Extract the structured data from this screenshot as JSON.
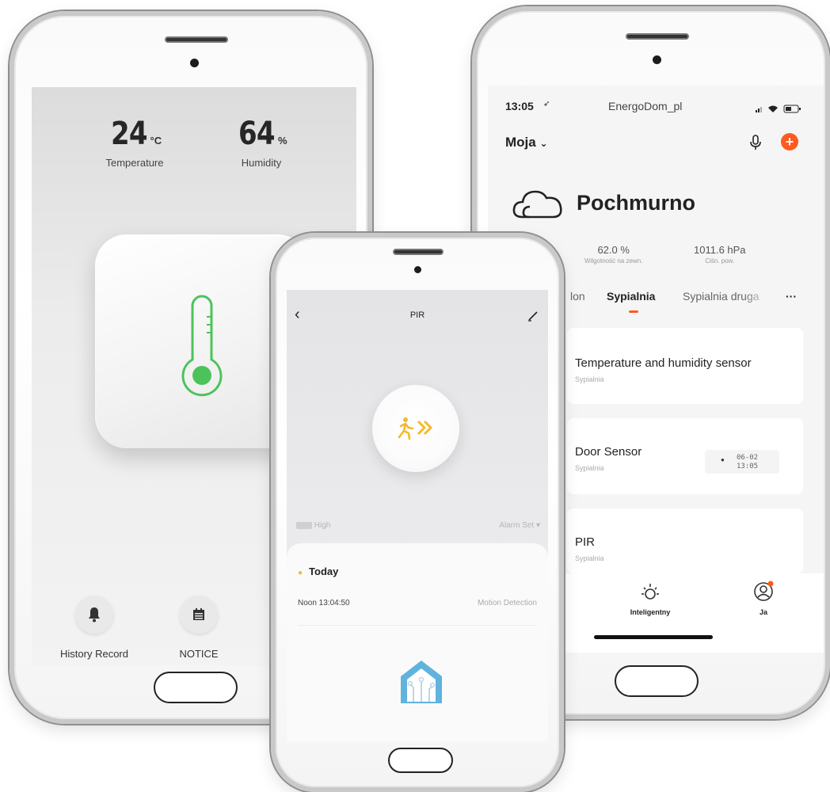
{
  "left_app": {
    "temperature_value": "24",
    "temperature_unit": "°C",
    "temperature_label": "Temperature",
    "humidity_value": "64",
    "humidity_unit": "%",
    "humidity_label": "Humidity",
    "history_label": "History Record",
    "notice_label": "NOTICE"
  },
  "right_app": {
    "status_time": "13:05",
    "carrier": "EnergoDom_pl",
    "home_name": "Moja",
    "weather": "Pochmurno",
    "stats": [
      {
        "value": "62.0 %",
        "label": "Wilgotność na zewn."
      },
      {
        "value": "1011.6 hPa",
        "label": "Ciśn. pow."
      }
    ],
    "rooms": [
      "lon",
      "Sypialnia",
      "Sypialnia druga"
    ],
    "more": "···",
    "devices": [
      {
        "name": "Temperature and humidity sensor",
        "room": "Sypialnia"
      },
      {
        "name": "Door Sensor",
        "room": "Sypialnia",
        "badge_date": "06-02",
        "badge_time": "13:05"
      },
      {
        "name": "PIR",
        "room": "Sypialnia"
      }
    ],
    "tabs": [
      {
        "label": "Inteligentny"
      },
      {
        "label": "Ja"
      }
    ],
    "accent_color": "#ff5a1f"
  },
  "mid_app": {
    "title": "PIR",
    "battery_label": "High",
    "alarm_label": "Alarm Set ▾",
    "day_label": "Today",
    "event_time": "Noon 13:04:50",
    "event_type": "Motion Detection",
    "accent_color": "#f5b82e"
  }
}
